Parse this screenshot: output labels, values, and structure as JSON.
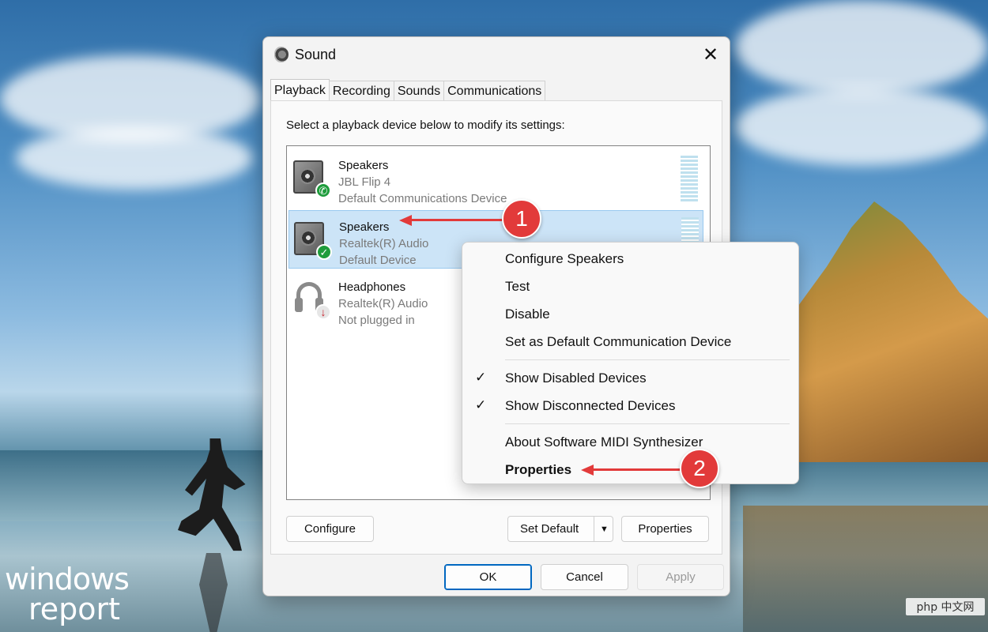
{
  "dialog": {
    "title": "Sound",
    "close_glyph": "✕",
    "tabs": [
      {
        "label": "Playback",
        "active": true
      },
      {
        "label": "Recording",
        "active": false
      },
      {
        "label": "Sounds",
        "active": false
      },
      {
        "label": "Communications",
        "active": false
      }
    ],
    "instruction": "Select a playback device below to modify its settings:",
    "devices": [
      {
        "name": "Speakers",
        "detail": "JBL Flip 4",
        "status": "Default Communications Device",
        "icon": "speaker-icon",
        "badge": "phone-badge-icon",
        "badge_glyph": "✆",
        "selected": false
      },
      {
        "name": "Speakers",
        "detail": "Realtek(R) Audio",
        "status": "Default Device",
        "icon": "speaker-icon",
        "badge": "default-check-badge-icon",
        "badge_glyph": "✓",
        "selected": true
      },
      {
        "name": "Headphones",
        "detail": "Realtek(R) Audio",
        "status": "Not plugged in",
        "icon": "headphones-icon",
        "badge": "unplugged-badge-icon",
        "badge_glyph": "↓",
        "selected": false
      }
    ],
    "buttons": {
      "configure": "Configure",
      "set_default": "Set Default",
      "set_default_arrow": "▼",
      "properties": "Properties",
      "ok": "OK",
      "cancel": "Cancel",
      "apply": "Apply"
    }
  },
  "context_menu": {
    "items": [
      {
        "label": "Configure Speakers",
        "checked": false,
        "bold": false
      },
      {
        "label": "Test",
        "checked": false,
        "bold": false
      },
      {
        "label": "Disable",
        "checked": false,
        "bold": false
      },
      {
        "label": "Set as Default Communication Device",
        "checked": false,
        "bold": false
      },
      {
        "label": "Show Disabled Devices",
        "checked": true,
        "bold": false
      },
      {
        "label": "Show Disconnected Devices",
        "checked": true,
        "bold": false
      },
      {
        "label": "About Software MIDI Synthesizer",
        "checked": false,
        "bold": false
      },
      {
        "label": "Properties",
        "checked": false,
        "bold": true
      }
    ],
    "check_glyph": "✓"
  },
  "annotations": [
    {
      "number": "1"
    },
    {
      "number": "2"
    }
  ],
  "watermark": {
    "line1": "windows",
    "line2": "report"
  },
  "corner_badge": "php 中文网",
  "colors": {
    "selection": "#cce4f7",
    "callout": "#e23a3a",
    "accent": "#0067c0"
  }
}
